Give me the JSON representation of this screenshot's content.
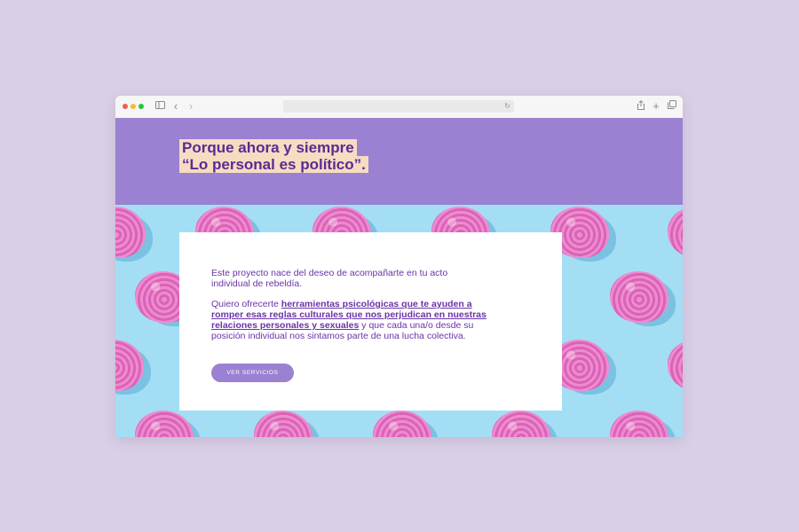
{
  "browser": {
    "icons": {
      "sidebar": "sidebar-icon",
      "back": "chevron-left-icon",
      "forward": "chevron-right-icon",
      "reload": "reload-icon",
      "share": "share-icon",
      "new_tab": "plus-icon",
      "tabs": "tabs-icon"
    },
    "colors": {
      "close": "#ee5f57",
      "minimize": "#f6bc32",
      "zoom": "#29c33f"
    }
  },
  "hero": {
    "line1": "Porque ahora y siempre",
    "line2": "“Lo personal es político”.",
    "background": "#9a81d1",
    "highlight": "#f6dcc1"
  },
  "card": {
    "paragraph1": "Este proyecto nace del deseo de acompañarte en tu acto individual de rebeldía.",
    "paragraph2_intro": "Quiero ofrecerte ",
    "paragraph2_link": "herramientas psicológicas que te ayuden a romper esas reglas culturales que nos perjudican en nuestras relaciones personales y sexuales",
    "paragraph2_rest": " y que cada una/o desde su posición individual nos sintamos parte de una lucha colectiva.",
    "button_label": "VER SERVICIOS",
    "text_color": "#6a33a8"
  },
  "pattern": {
    "background": "#a3def5",
    "motif": "pink-brain"
  }
}
